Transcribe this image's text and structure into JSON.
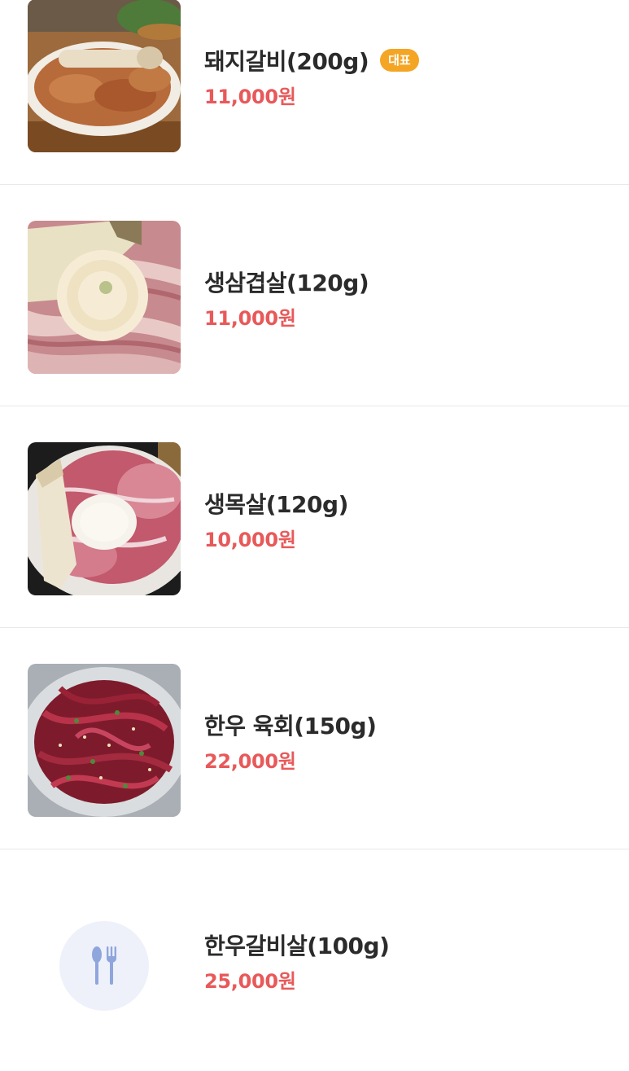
{
  "menu": {
    "items": [
      {
        "name": "돼지갈비(200g)",
        "badge": "대표",
        "price": "11,000원",
        "image": "photo-pork-galbi"
      },
      {
        "name": "생삼겹살(120g)",
        "price": "11,000원",
        "image": "photo-pork-belly"
      },
      {
        "name": "생목살(120g)",
        "price": "10,000원",
        "image": "photo-pork-neck"
      },
      {
        "name": "한우 육회(150g)",
        "price": "22,000원",
        "image": "photo-beef-yukhoe"
      },
      {
        "name": "한우갈비살(100g)",
        "price": "25,000원",
        "image": "utensils-icon"
      }
    ]
  },
  "colors": {
    "price": "#e8595a",
    "badge": "#f5a524",
    "name": "#2b2b2b",
    "divider": "#e9e9ec",
    "placeholder_bg": "#eef1fa",
    "placeholder_icon": "#8fa6dc"
  }
}
